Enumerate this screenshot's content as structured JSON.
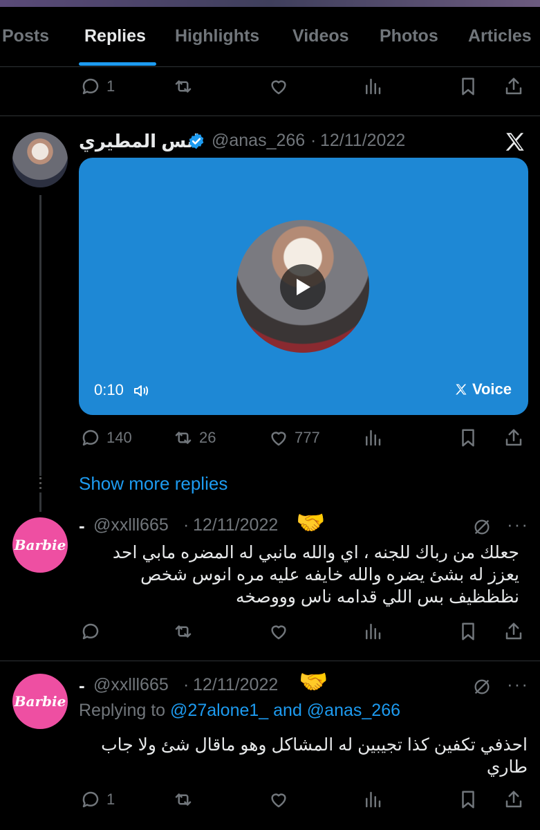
{
  "tabs": [
    "Posts",
    "Replies",
    "Highlights",
    "Videos",
    "Photos",
    "Articles"
  ],
  "top_actions": {
    "replies": "1"
  },
  "post_anas": {
    "name": "انس المطيري",
    "handle": "@anas_266",
    "date": "12/11/2022",
    "media": {
      "duration": "0:10",
      "label": "Voice"
    },
    "replies": "140",
    "reposts": "26",
    "likes": "777"
  },
  "show_more": "Show more replies",
  "reply1": {
    "name": "-",
    "handle": "@xxlll665",
    "date": "12/11/2022",
    "emoji": "🤝",
    "text_line1": "جعلك من رباك للجنه ، اي والله مانبي له المضره مابي احد",
    "text_line2": "يعزز له بشئ يضره والله خايفه عليه مره انوس شخص",
    "text_line3": "نظظظيف بس اللي قدامه ناس وووصخه",
    "avatar_text": "Barbie"
  },
  "reply2": {
    "name": "-",
    "handle": "@xxlll665",
    "date": "12/11/2022",
    "emoji": "🤝",
    "replying_prefix": "Replying to",
    "replying_mentions": "@27alone1_ and @anas_266",
    "text_line1": "احذفي تكفين كذا تجيبين له المشاكل وهو ماقال شئ ولا جاب",
    "text_line2": "طاري",
    "replies": "1",
    "avatar_text": "Barbie"
  },
  "colors": {
    "accent": "#1d9bf0",
    "media_bg": "#1e88d5",
    "muted": "#71767b",
    "barbie": "#ee4fa2"
  }
}
